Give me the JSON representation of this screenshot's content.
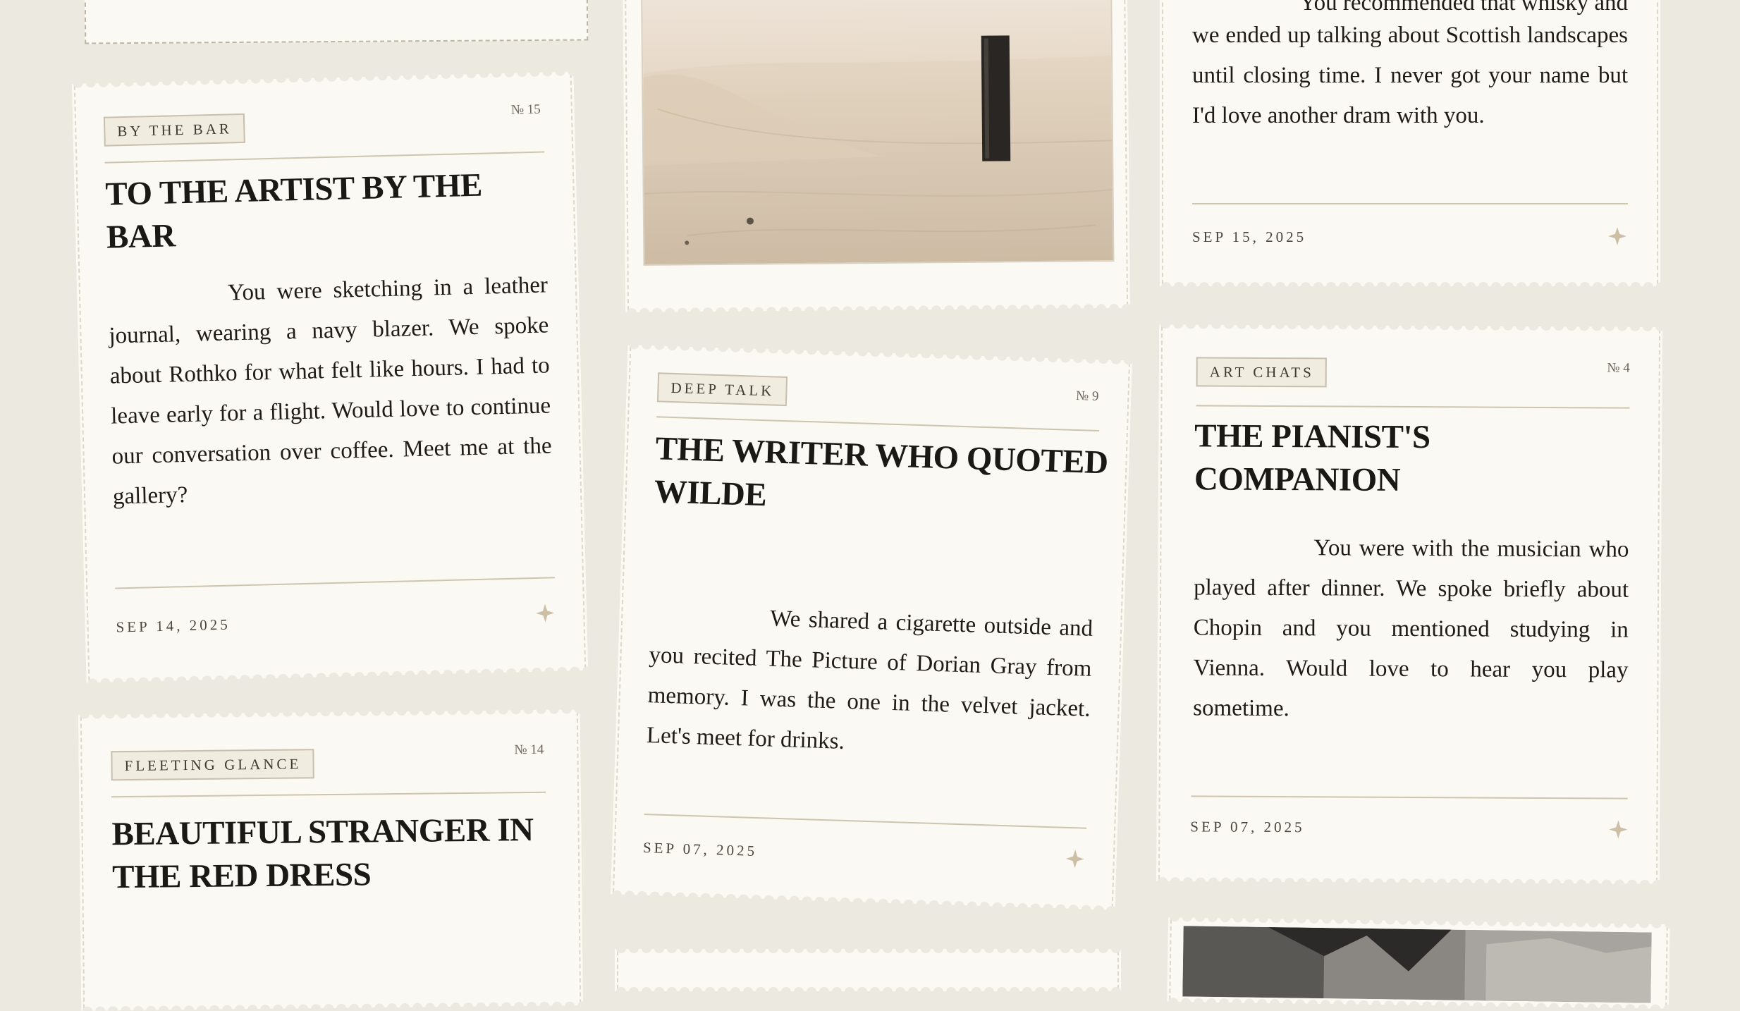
{
  "cards": {
    "bar": {
      "tag": "BY THE BAR",
      "number": "№ 15",
      "title": "TO THE ARTIST BY THE BAR",
      "body": "You were sketching in a leather journal, wearing a navy blazer. We spoke about Rothko for what felt like hours. I had to leave early for a flight. Would love to continue our conversation over coffee. Meet me at the gallery?",
      "date": "SEP 14, 2025"
    },
    "glance": {
      "tag": "FLEETING GLANCE",
      "number": "№ 14",
      "title": "BEAUTIFUL STRANGER IN THE RED DRESS"
    },
    "writer": {
      "tag": "DEEP TALK",
      "number": "№ 9",
      "title": "THE WRITER WHO QUOTED WILDE",
      "body": "We shared a cigarette outside and you recited The Picture of Dorian Gray from memory. I was the one in the velvet jacket. Let's meet for drinks.",
      "date": "SEP 07, 2025"
    },
    "whisky": {
      "body_partial_top": "You recommended that whisky and",
      "body": "we ended up talking about Scottish landscapes until closing time. I never got your name but I'd love another dram with you.",
      "date": "SEP 15, 2025"
    },
    "pianist": {
      "tag": "ART CHATS",
      "number": "№ 4",
      "title": "THE PIANIST'S COMPANION",
      "body": "You were with the musician who played after dinner. We spoke briefly about Chopin and you mentioned studying in Vienna. Would love to hear you play sometime.",
      "date": "SEP 07, 2025"
    }
  },
  "icons": {
    "star": "four-point-star-icon"
  },
  "colors": {
    "background": "#ece9e1",
    "card": "#fbf9f3",
    "accent": "#c8b9a0",
    "ink": "#1b1916"
  }
}
